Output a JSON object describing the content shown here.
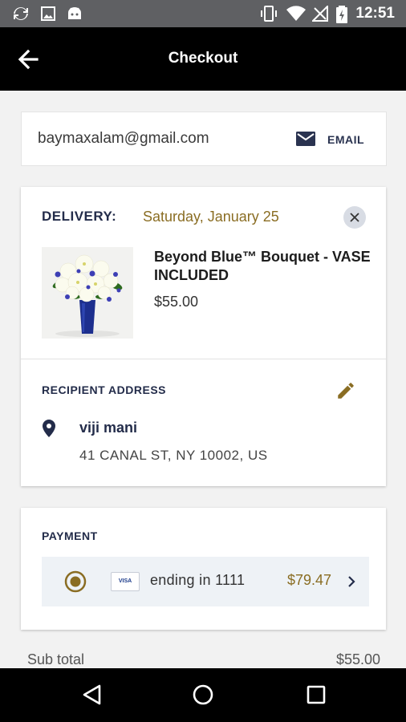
{
  "status_bar": {
    "time": "12:51",
    "icons": [
      "sync-icon",
      "image-icon",
      "android-icon",
      "vibrate-icon",
      "wifi-icon",
      "no-signal-icon",
      "battery-charging-icon"
    ]
  },
  "header": {
    "title": "Checkout",
    "back_icon": "arrow-left-icon"
  },
  "email": {
    "address": "baymaxalam@gmail.com",
    "action_label": "EMAIL",
    "icon": "mail-icon"
  },
  "delivery": {
    "label": "DELIVERY:",
    "date": "Saturday, January 25",
    "close_icon": "close-icon",
    "product": {
      "name": "Beyond Blue™ Bouquet - VASE INCLUDED",
      "price": "$55.00"
    },
    "recipient": {
      "section_label": "RECIPIENT ADDRESS",
      "edit_icon": "pencil-icon",
      "name": "viji mani",
      "address": "41 CANAL ST, NY 10002, US"
    }
  },
  "payment": {
    "label": "PAYMENT",
    "card_brand": "VISA",
    "card_ending": "ending in 1111",
    "amount": "$79.47"
  },
  "summary": {
    "subtotal_label": "Sub total",
    "subtotal_value": "$55.00"
  },
  "colors": {
    "accent_gold": "#8a6d23",
    "navy": "#232c4a",
    "app_bar": "#000000"
  }
}
